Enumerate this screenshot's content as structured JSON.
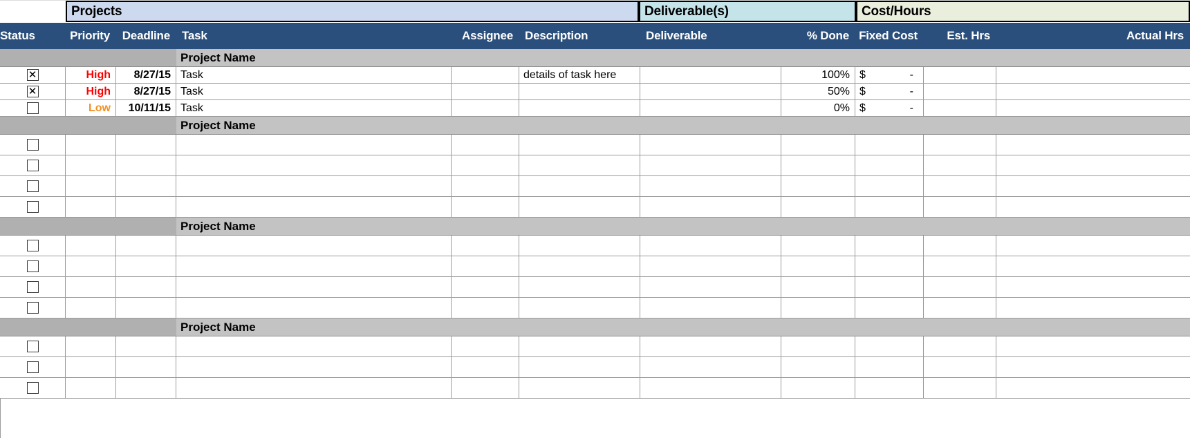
{
  "banners": [
    {
      "label": "",
      "key": "blank"
    },
    {
      "label": "Projects",
      "key": "projects"
    },
    {
      "label": "Deliverable(s)",
      "key": "deliverables"
    },
    {
      "label": "Cost/Hours",
      "key": "cost_hours"
    }
  ],
  "columns": [
    {
      "label": "Status",
      "align": "center"
    },
    {
      "label": "Priority",
      "align": "right"
    },
    {
      "label": "Deadline",
      "align": "right"
    },
    {
      "label": "Task",
      "align": "left"
    },
    {
      "label": "Assignee",
      "align": "right"
    },
    {
      "label": "Description",
      "align": "left"
    },
    {
      "label": "Deliverable",
      "align": "left"
    },
    {
      "label": "% Done",
      "align": "right"
    },
    {
      "label": "Fixed Cost",
      "align": "right"
    },
    {
      "label": "Est. Hrs",
      "align": "right"
    },
    {
      "label": "Actual Hrs",
      "align": "right"
    }
  ],
  "group_label": "Project Name",
  "checkbox": {
    "checked_glyph": "☒",
    "unchecked_glyph": ""
  },
  "colors": {
    "header_navy": "#2a4f7c",
    "banner_projects": "#ccd9ee",
    "banner_deliverables": "#c5e4ea",
    "banner_cost": "#eaeedd",
    "group_gray": "#b0b0b0",
    "group_gray_light": "#c3c3c3",
    "priority_high": "#ff0000",
    "priority_low": "#f4901e",
    "grid_line": "#9a9a9a"
  },
  "groups": [
    {
      "name": "Project Name",
      "rows": [
        {
          "status": true,
          "priority": "High",
          "priority_level": "high",
          "deadline": "8/27/15",
          "task": "Task",
          "assignee": "",
          "description": "details of task here",
          "deliverable": "",
          "percent_done": "100%",
          "fixed_cost_symbol": "$",
          "fixed_cost_value": "-",
          "est_hrs": "",
          "actual_hrs": ""
        },
        {
          "status": true,
          "priority": "High",
          "priority_level": "high",
          "deadline": "8/27/15",
          "task": "Task",
          "assignee": "",
          "description": "",
          "deliverable": "",
          "percent_done": "50%",
          "fixed_cost_symbol": "$",
          "fixed_cost_value": "-",
          "est_hrs": "",
          "actual_hrs": ""
        },
        {
          "status": false,
          "priority": "Low",
          "priority_level": "low",
          "deadline": "10/11/15",
          "task": "Task",
          "assignee": "",
          "description": "",
          "deliverable": "",
          "percent_done": "0%",
          "fixed_cost_symbol": "$",
          "fixed_cost_value": "-",
          "est_hrs": "",
          "actual_hrs": ""
        }
      ]
    },
    {
      "name": "Project Name",
      "rows": [
        {
          "status": false,
          "priority": "",
          "priority_level": "",
          "deadline": "",
          "task": "",
          "assignee": "",
          "description": "",
          "deliverable": "",
          "percent_done": "",
          "fixed_cost_symbol": "",
          "fixed_cost_value": "",
          "est_hrs": "",
          "actual_hrs": ""
        },
        {
          "status": false,
          "priority": "",
          "priority_level": "",
          "deadline": "",
          "task": "",
          "assignee": "",
          "description": "",
          "deliverable": "",
          "percent_done": "",
          "fixed_cost_symbol": "",
          "fixed_cost_value": "",
          "est_hrs": "",
          "actual_hrs": ""
        },
        {
          "status": false,
          "priority": "",
          "priority_level": "",
          "deadline": "",
          "task": "",
          "assignee": "",
          "description": "",
          "deliverable": "",
          "percent_done": "",
          "fixed_cost_symbol": "",
          "fixed_cost_value": "",
          "est_hrs": "",
          "actual_hrs": ""
        },
        {
          "status": false,
          "priority": "",
          "priority_level": "",
          "deadline": "",
          "task": "",
          "assignee": "",
          "description": "",
          "deliverable": "",
          "percent_done": "",
          "fixed_cost_symbol": "",
          "fixed_cost_value": "",
          "est_hrs": "",
          "actual_hrs": ""
        }
      ]
    },
    {
      "name": "Project Name",
      "rows": [
        {
          "status": false,
          "priority": "",
          "priority_level": "",
          "deadline": "",
          "task": "",
          "assignee": "",
          "description": "",
          "deliverable": "",
          "percent_done": "",
          "fixed_cost_symbol": "",
          "fixed_cost_value": "",
          "est_hrs": "",
          "actual_hrs": ""
        },
        {
          "status": false,
          "priority": "",
          "priority_level": "",
          "deadline": "",
          "task": "",
          "assignee": "",
          "description": "",
          "deliverable": "",
          "percent_done": "",
          "fixed_cost_symbol": "",
          "fixed_cost_value": "",
          "est_hrs": "",
          "actual_hrs": ""
        },
        {
          "status": false,
          "priority": "",
          "priority_level": "",
          "deadline": "",
          "task": "",
          "assignee": "",
          "description": "",
          "deliverable": "",
          "percent_done": "",
          "fixed_cost_symbol": "",
          "fixed_cost_value": "",
          "est_hrs": "",
          "actual_hrs": ""
        },
        {
          "status": false,
          "priority": "",
          "priority_level": "",
          "deadline": "",
          "task": "",
          "assignee": "",
          "description": "",
          "deliverable": "",
          "percent_done": "",
          "fixed_cost_symbol": "",
          "fixed_cost_value": "",
          "est_hrs": "",
          "actual_hrs": ""
        }
      ]
    },
    {
      "name": "Project Name",
      "rows": [
        {
          "status": false,
          "priority": "",
          "priority_level": "",
          "deadline": "",
          "task": "",
          "assignee": "",
          "description": "",
          "deliverable": "",
          "percent_done": "",
          "fixed_cost_symbol": "",
          "fixed_cost_value": "",
          "est_hrs": "",
          "actual_hrs": ""
        },
        {
          "status": false,
          "priority": "",
          "priority_level": "",
          "deadline": "",
          "task": "",
          "assignee": "",
          "description": "",
          "deliverable": "",
          "percent_done": "",
          "fixed_cost_symbol": "",
          "fixed_cost_value": "",
          "est_hrs": "",
          "actual_hrs": ""
        },
        {
          "status": false,
          "priority": "",
          "priority_level": "",
          "deadline": "",
          "task": "",
          "assignee": "",
          "description": "",
          "deliverable": "",
          "percent_done": "",
          "fixed_cost_symbol": "",
          "fixed_cost_value": "",
          "est_hrs": "",
          "actual_hrs": ""
        }
      ]
    }
  ]
}
